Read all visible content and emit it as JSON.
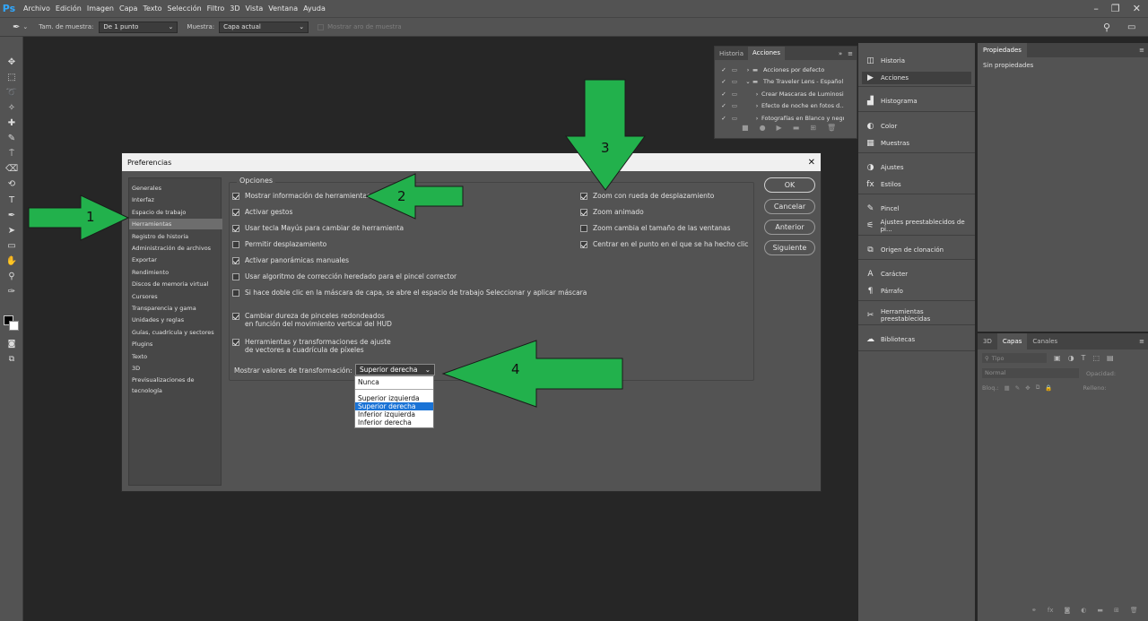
{
  "app": {
    "logo": "Ps",
    "accent": "#31a8ff"
  },
  "menubar": {
    "items": [
      "Archivo",
      "Edición",
      "Imagen",
      "Capa",
      "Texto",
      "Selección",
      "Filtro",
      "3D",
      "Vista",
      "Ventana",
      "Ayuda"
    ],
    "controls": [
      "–",
      "❐",
      "✕"
    ]
  },
  "optionsbar": {
    "sample_size_label": "Tam. de muestra:",
    "sample_size_value": "De 1 punto",
    "sample_label": "Muestra:",
    "sample_value": "Capa actual",
    "show_ring_label": "Mostrar aro de muestra"
  },
  "history_panel": {
    "tabs": [
      "Historia",
      "Acciones"
    ],
    "rows": [
      {
        "label": "Acciones por defecto"
      },
      {
        "label": "The Traveler Lens - Español"
      },
      {
        "label": "Crear Mascaras de Luminosi..."
      },
      {
        "label": "Efecto de noche en fotos d..."
      },
      {
        "label": "Fotografías en Blanco y negro"
      }
    ]
  },
  "right_column": {
    "items": [
      {
        "icon": "history-icon",
        "glyph": "◫",
        "label": "Historia"
      },
      {
        "icon": "play-icon",
        "glyph": "▶",
        "label": "Acciones"
      },
      {
        "icon": "histogram-icon",
        "glyph": "▟",
        "label": "Histograma"
      },
      {
        "icon": "color-icon",
        "glyph": "◐",
        "label": "Color"
      },
      {
        "icon": "swatches-icon",
        "glyph": "▦",
        "label": "Muestras"
      },
      {
        "icon": "adjustments-icon",
        "glyph": "◑",
        "label": "Ajustes"
      },
      {
        "icon": "styles-icon",
        "glyph": "fx",
        "label": "Estilos"
      },
      {
        "icon": "brush-icon",
        "glyph": "✎",
        "label": "Pincel"
      },
      {
        "icon": "brush-presets-icon",
        "glyph": "⚟",
        "label": "Ajustes preestablecidos de pi..."
      },
      {
        "icon": "clone-source-icon",
        "glyph": "⧉",
        "label": "Origen de clonación"
      },
      {
        "icon": "character-icon",
        "glyph": "A",
        "label": "Carácter"
      },
      {
        "icon": "paragraph-icon",
        "glyph": "¶",
        "label": "Párrafo"
      },
      {
        "icon": "tool-presets-icon",
        "glyph": "✂",
        "label": "Herramientas preestablecidas"
      },
      {
        "icon": "libraries-icon",
        "glyph": "☁",
        "label": "Bibliotecas"
      }
    ]
  },
  "properties": {
    "tab": "Propiedades",
    "empty": "Sin propiedades"
  },
  "layers": {
    "tabs": [
      "3D",
      "Capas",
      "Canales"
    ],
    "search_placeholder": "Tipo",
    "blend_mode": "Normal",
    "opacity_label": "Opacidad:",
    "lock_label": "Bloq.:",
    "fill_label": "Relleno:"
  },
  "dialog": {
    "title": "Preferencias",
    "close": "✕",
    "nav": [
      "Generales",
      "Interfaz",
      "Espacio de trabajo",
      "Herramientas",
      "Registro de historia",
      "Administración de archivos",
      "Exportar",
      "Rendimiento",
      "Discos de memoria virtual",
      "Cursores",
      "Transparencia y gama",
      "Unidades y reglas",
      "Guías, cuadrícula y sectores",
      "Plugins",
      "Texto",
      "3D",
      "Previsualizaciones de tecnología"
    ],
    "selected_nav": "Herramientas",
    "group_label": "Opciones",
    "left_options": [
      {
        "label": "Mostrar información de herramientas",
        "checked": true
      },
      {
        "label": "Activar gestos",
        "checked": true
      },
      {
        "label": "Usar tecla Mayús para cambiar de herramienta",
        "checked": true
      },
      {
        "label": "Permitir desplazamiento",
        "checked": false
      },
      {
        "label": "Activar panorámicas manuales",
        "checked": true
      },
      {
        "label": "Usar algoritmo de corrección heredado para el pincel corrector",
        "checked": false
      },
      {
        "label": "Si hace doble clic en la máscara de capa, se abre el espacio de trabajo Seleccionar y aplicar máscara",
        "checked": false
      },
      {
        "label": "Cambiar dureza de pinceles redondeados\nen función del movimiento vertical del HUD",
        "checked": true
      },
      {
        "label": "Herramientas y transformaciones de ajuste\nde vectores a cuadrícula de píxeles",
        "checked": true
      }
    ],
    "right_options": [
      {
        "label": "Zoom con rueda de desplazamiento",
        "checked": true
      },
      {
        "label": "Zoom animado",
        "checked": true
      },
      {
        "label": "Zoom cambia el tamaño de las ventanas",
        "checked": false
      },
      {
        "label": "Centrar en el punto en el que se ha hecho clic",
        "checked": true
      }
    ],
    "transform_label": "Mostrar valores de transformación:",
    "transform_value": "Superior derecha",
    "dropdown_options": [
      "Nunca",
      "Superior izquierda",
      "Superior derecha",
      "Inferior izquierda",
      "Inferior derecha"
    ],
    "dropdown_selected": "Superior derecha",
    "buttons": {
      "ok": "OK",
      "cancel": "Cancelar",
      "prev": "Anterior",
      "next": "Siguiente"
    }
  },
  "annotations": {
    "arrow_color": "#22b14c",
    "labels": [
      "1",
      "2",
      "3",
      "4"
    ]
  }
}
